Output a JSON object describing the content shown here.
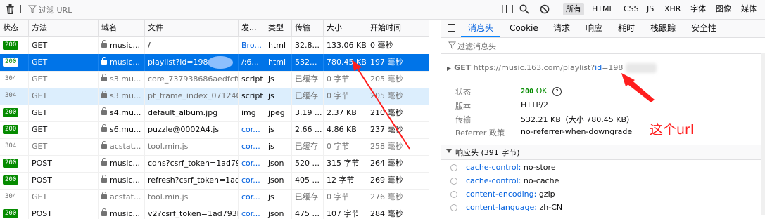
{
  "toolbar": {
    "filter_placeholder": "过滤 URL",
    "filter_types": [
      "所有",
      "HTML",
      "CSS",
      "JS",
      "XHR",
      "字体",
      "图像",
      "媒体"
    ],
    "icons": [
      "trash-icon",
      "filter-icon",
      "pause-icon",
      "search-icon",
      "block-icon"
    ]
  },
  "table": {
    "columns": [
      "状态",
      "方法",
      "域名",
      "文件",
      "发...",
      "类型",
      "传输",
      "大小",
      "开始时间"
    ],
    "rows": [
      {
        "status": "200",
        "method": "GET",
        "domain": "music...",
        "file": "/",
        "cause": "Bro...",
        "type": "html",
        "transfer": "32.8...",
        "size": "133.06 KB",
        "start": "0 毫秒"
      },
      {
        "status": "200",
        "method": "GET",
        "domain": "music...",
        "file": "playlist?id=198",
        "cause": "/:6...",
        "type": "html",
        "transfer": "532...",
        "size": "780.45 KB",
        "start": "197 毫秒"
      },
      {
        "status": "304",
        "method": "GET",
        "domain": "s3.mu...",
        "file": "core_737938686aedfcff6",
        "cause": "script",
        "type": "js",
        "transfer": "已缓存",
        "size": "0 字节",
        "start": "205 毫秒"
      },
      {
        "status": "304",
        "method": "GET",
        "domain": "s3.mu...",
        "file": "pt_frame_index_071240:",
        "cause": "script",
        "type": "js",
        "transfer": "已缓存",
        "size": "0 字节",
        "start": "205 毫秒"
      },
      {
        "status": "200",
        "method": "GET",
        "domain": "s4.mu...",
        "file": "default_album.jpg",
        "cause": "img",
        "type": "jpeg",
        "transfer": "3.19 ...",
        "size": "2.37 KB",
        "start": "210 毫秒"
      },
      {
        "status": "200",
        "method": "GET",
        "domain": "s6.mu...",
        "file": "puzzle@0002A4.js",
        "cause": "cor...",
        "type": "js",
        "transfer": "2.66 ...",
        "size": "4.86 KB",
        "start": "237 毫秒"
      },
      {
        "status": "304",
        "method": "GET",
        "domain": "acstat...",
        "file": "tool.min.js",
        "cause": "cor...",
        "type": "js",
        "transfer": "已缓存",
        "size": "0 字节",
        "start": "258 毫秒"
      },
      {
        "status": "200",
        "method": "POST",
        "domain": "music...",
        "file": "cdns?csrf_token=1ad793",
        "cause": "cor...",
        "type": "json",
        "transfer": "520 ...",
        "size": "315 字节",
        "start": "264 毫秒"
      },
      {
        "status": "200",
        "method": "POST",
        "domain": "music...",
        "file": "refresh?csrf_token=1ad7",
        "cause": "cor...",
        "type": "json",
        "transfer": "405 ...",
        "size": "12 字节",
        "start": "269 毫秒"
      },
      {
        "status": "304",
        "method": "GET",
        "domain": "acstat...",
        "file": "tool.min.js",
        "cause": "cor...",
        "type": "js",
        "transfer": "已缓存",
        "size": "0 字节",
        "start": "276 毫秒"
      },
      {
        "status": "200",
        "method": "POST",
        "domain": "music...",
        "file": "v2?csrf_token=1ad793b",
        "cause": "cor...",
        "type": "json",
        "transfer": "475 ...",
        "size": "107 字节",
        "start": "284 毫秒"
      }
    ]
  },
  "panel": {
    "tabs": [
      "消息头",
      "Cookie",
      "请求",
      "响应",
      "耗时",
      "栈跟踪",
      "安全性"
    ],
    "filter_placeholder": "过滤消息头",
    "request_method": "GET",
    "request_url_prefix": "https://music.163.com/playlist?",
    "request_url_param": "id",
    "request_url_value": "=198",
    "fields": {
      "status_label": "状态",
      "status_code": "200",
      "status_text": "OK",
      "version_label": "版本",
      "version_value": "HTTP/2",
      "transfer_label": "传输",
      "transfer_value": "532.21 KB（大小 780.45 KB）",
      "referrer_label": "Referrer 政策",
      "referrer_value": "no-referrer-when-downgrade"
    },
    "response_section_title": "响应头 (391 字节)",
    "response_headers": [
      {
        "key": "cache-control:",
        "value": "no-store"
      },
      {
        "key": "cache-control:",
        "value": "no-cache"
      },
      {
        "key": "content-encoding:",
        "value": "gzip"
      },
      {
        "key": "content-language:",
        "value": "zh-CN"
      }
    ]
  },
  "annotation": {
    "text": "这个url",
    "color": "#ff1e1e"
  },
  "colors": {
    "accent": "#0074e8",
    "status_ok": "#058b00",
    "link": "#0060df"
  }
}
